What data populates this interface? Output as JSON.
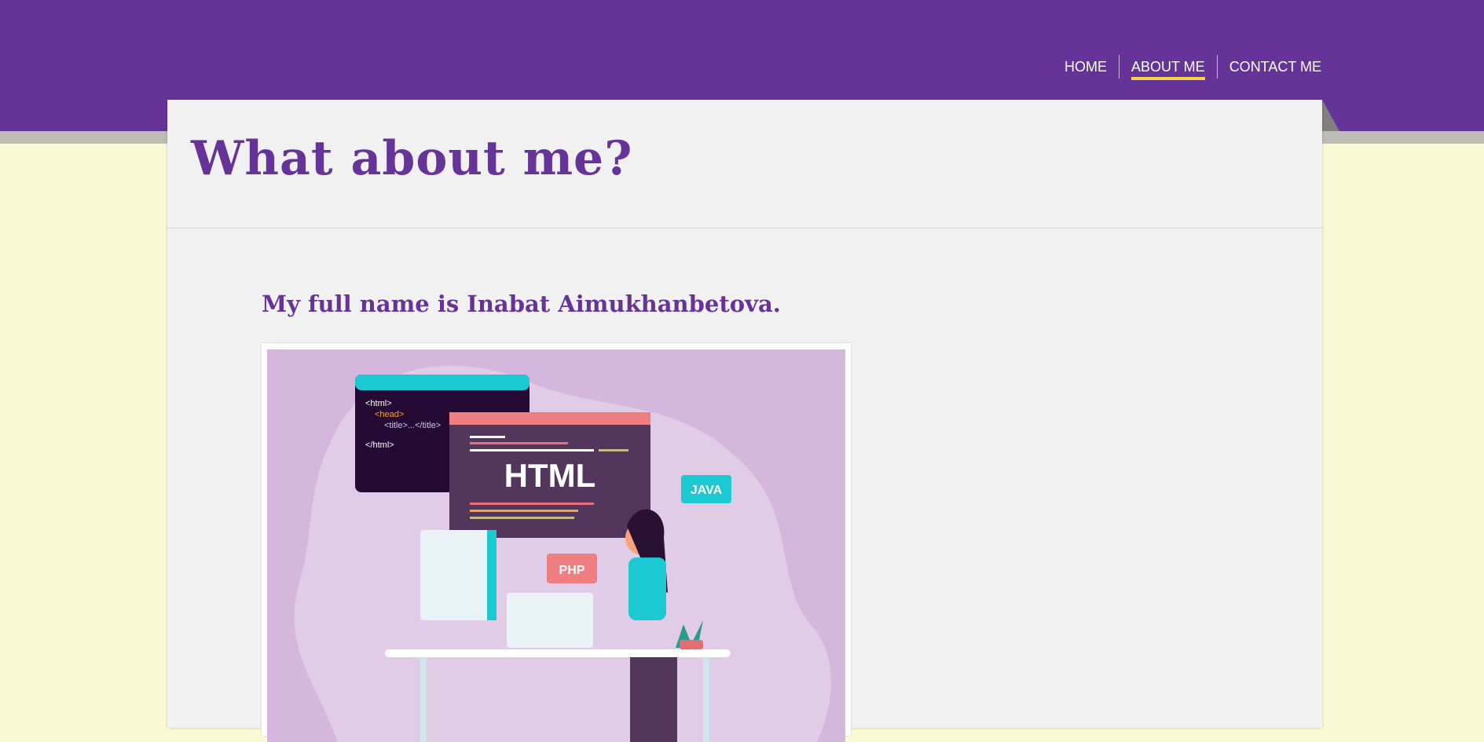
{
  "nav": {
    "items": [
      {
        "label": "HOME"
      },
      {
        "label": "ABOUT ME",
        "active": true
      },
      {
        "label": "CONTACT ME"
      }
    ]
  },
  "page": {
    "title": "What about me?",
    "subtitle": "My full name is Inabat Aimukhanbetova."
  },
  "illustration": {
    "code_lines": [
      "<html>",
      "<head>",
      "<title>...</title>",
      "</html>"
    ],
    "window_label": "HTML",
    "bubble_java": "JAVA",
    "bubble_php": "PHP"
  },
  "colors": {
    "brand": "#663399",
    "accent": "#f5d547",
    "background": "#f9f9d3",
    "card": "#f1f1f1"
  }
}
